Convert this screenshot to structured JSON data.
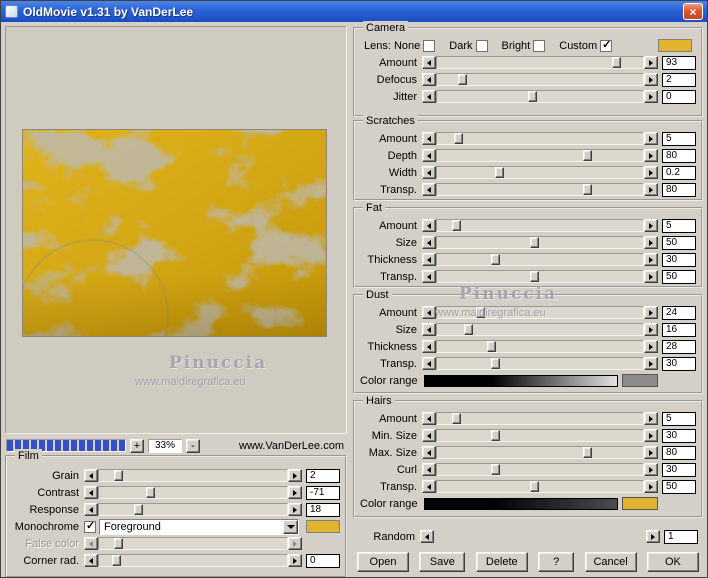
{
  "window": {
    "title": "OldMovie v1.31 by VanDerLee",
    "close": "×"
  },
  "colors": {
    "dialog": "#d4d0c8",
    "accent_gold": "#e0b22e",
    "progress_blue": "#3350cb",
    "titlebar_blue": "#2a62d8"
  },
  "watermark": {
    "name": "Pinuccia",
    "url": "www.maidiregrafica.eu"
  },
  "preview": {
    "zoom_plus": "+",
    "zoom_value": "33%",
    "zoom_minus": "-",
    "site": "www.VanDerLee.com"
  },
  "camera": {
    "label": "Camera",
    "lens": {
      "lens_none": "Lens: None",
      "dark": "Dark",
      "bright": "Bright",
      "custom": "Custom",
      "none_checked": false,
      "dark_checked": false,
      "bright_checked": false,
      "custom_checked": true,
      "custom_color": "#e0b22e"
    },
    "amount": {
      "label": "Amount",
      "value": "93",
      "pos": 87
    },
    "defocus": {
      "label": "Defocus",
      "value": "2",
      "pos": 12
    },
    "jitter": {
      "label": "Jitter",
      "value": "0",
      "pos": 46
    }
  },
  "scratches": {
    "label": "Scratches",
    "amount": {
      "label": "Amount",
      "value": "5",
      "pos": 10
    },
    "depth": {
      "label": "Depth",
      "value": "80",
      "pos": 73
    },
    "width": {
      "label": "Width",
      "value": "0.2",
      "pos": 30
    },
    "transp": {
      "label": "Transp.",
      "value": "80",
      "pos": 73
    }
  },
  "fat": {
    "label": "Fat",
    "amount": {
      "label": "Amount",
      "value": "5",
      "pos": 9
    },
    "size": {
      "label": "Size",
      "value": "50",
      "pos": 47
    },
    "thickness": {
      "label": "Thickness",
      "value": "30",
      "pos": 28
    },
    "transp": {
      "label": "Transp.",
      "value": "50",
      "pos": 47
    }
  },
  "dust": {
    "label": "Dust",
    "amount": {
      "label": "Amount",
      "value": "24",
      "pos": 21
    },
    "size": {
      "label": "Size",
      "value": "16",
      "pos": 15
    },
    "thickness": {
      "label": "Thickness",
      "value": "28",
      "pos": 26
    },
    "transp": {
      "label": "Transp.",
      "value": "30",
      "pos": 28
    },
    "color_range": {
      "label": "Color range",
      "from": "#000000",
      "to": "#e2e2e2",
      "swatch": "#8c8c8c"
    }
  },
  "hairs": {
    "label": "Hairs",
    "amount": {
      "label": "Amount",
      "value": "5",
      "pos": 9
    },
    "min_size": {
      "label": "Min. Size",
      "value": "30",
      "pos": 28
    },
    "max_size": {
      "label": "Max. Size",
      "value": "80",
      "pos": 73
    },
    "curl": {
      "label": "Curl",
      "value": "30",
      "pos": 28
    },
    "transp": {
      "label": "Transp.",
      "value": "50",
      "pos": 47
    },
    "color_range": {
      "label": "Color range",
      "from": "#000000",
      "to": "#4a4a4a",
      "swatch": "#e0b22e"
    }
  },
  "random": {
    "label": "Random",
    "value": "1",
    "pos": 0,
    "notrack": true
  },
  "film": {
    "label": "Film",
    "grain": {
      "label": "Grain",
      "value": "2",
      "pos": 10
    },
    "contrast": {
      "label": "Contrast",
      "value": "-71",
      "pos": 27
    },
    "response": {
      "label": "Response",
      "value": "18",
      "pos": 21
    },
    "monochrome": {
      "label": "Monochrome",
      "checked": true,
      "select_value": "Foreground",
      "swatch": "#e0b22e"
    },
    "false_color": {
      "label": "False color",
      "pos": 10,
      "disabled": true
    },
    "corner": {
      "label": "Corner rad.",
      "value": "0",
      "pos": 9
    }
  },
  "buttons": {
    "open": "Open",
    "save": "Save",
    "delete": "Delete",
    "help": "?",
    "cancel": "Cancel",
    "ok": "OK"
  }
}
